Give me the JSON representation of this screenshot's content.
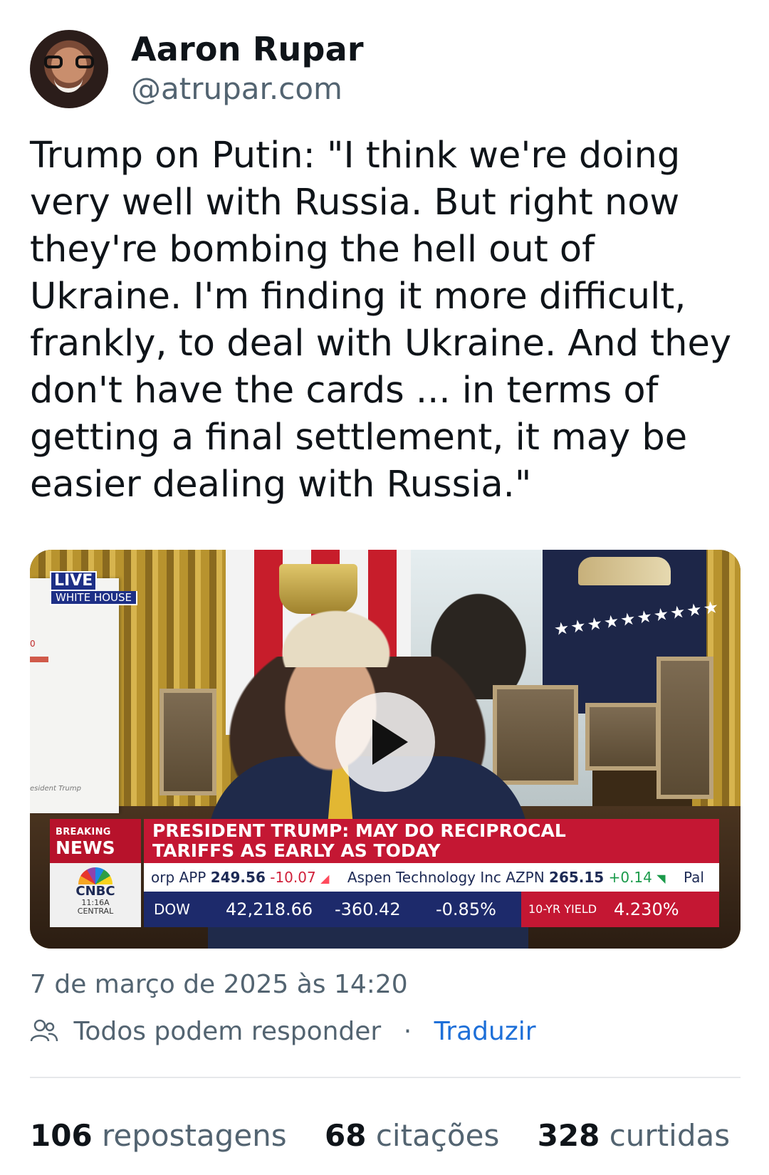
{
  "author": {
    "name": "Aaron Rupar",
    "handle": "@atrupar.com"
  },
  "post": {
    "text": "Trump on Putin: \"I think we're doing very well with Russia. But right now they're bombing the hell out of Ukraine. I'm finding it more difficult, frankly, to deal with Ukraine. And they don't have the cards ... in terms of getting a final settlement, it may be easier dealing with Russia.\""
  },
  "video": {
    "live_label": "LIVE",
    "location_label": "WHITE HOUSE",
    "board_value": "0",
    "board_caption": "esident Trump",
    "breaking_line1": "BREAKING",
    "breaking_line2": "NEWS",
    "headline_line1": "PRESIDENT TRUMP: MAY DO RECIPROCAL",
    "headline_line2": "TARIFFS AS EARLY AS TODAY",
    "network": "CNBC",
    "network_time": "11:16A",
    "network_zone": "CENTRAL",
    "ticker": {
      "s1_name": "orp APP",
      "s1_price": "249.56",
      "s1_change": "-10.07",
      "s2_name": "Aspen Technology Inc AZPN",
      "s2_price": "265.15",
      "s2_change": "+0.14",
      "s3_name": "Pal"
    },
    "index": {
      "label": "DOW",
      "value": "42,218.66",
      "change": "-360.42",
      "percent": "-0.85%"
    },
    "yield": {
      "label": "10-YR YIELD",
      "value": "4.230%"
    },
    "play_icon": "play-icon"
  },
  "meta": {
    "timestamp": "7 de março de 2025 às 14:20",
    "reply_setting": "Todos podem responder",
    "separator": "·",
    "translate": "Traduzir"
  },
  "stats": {
    "reposts_count": "106",
    "reposts_label": "repostagens",
    "quotes_count": "68",
    "quotes_label": "citações",
    "likes_count": "328",
    "likes_label": "curtidas"
  },
  "colors": {
    "link": "#1d6fd8",
    "secondary_text": "#536471",
    "breaking_red": "#c41733",
    "ticker_navy": "#1d2a6b"
  }
}
